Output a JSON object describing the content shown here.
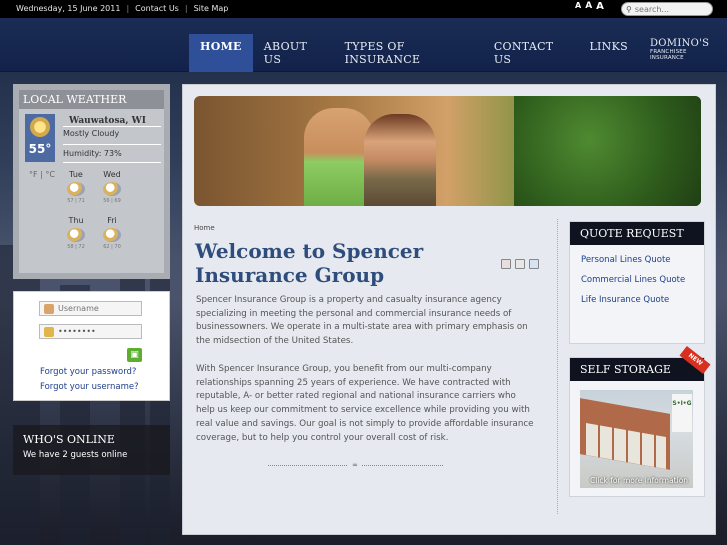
{
  "topbar": {
    "date": "Wednesday, 15 June 2011",
    "links": [
      "Contact Us",
      "Site Map"
    ],
    "font_sizes": [
      "A",
      "A",
      "A"
    ],
    "search_placeholder": "search..."
  },
  "nav": {
    "items": [
      "HOME",
      "ABOUT US",
      "TYPES OF INSURANCE",
      "CONTACT US",
      "LINKS"
    ],
    "dominos_line1": "DOMINO'S",
    "dominos_line2": "FRANCHISEE INSURANCE"
  },
  "weather": {
    "title": "LOCAL WEATHER",
    "city": "Wauwatosa, WI",
    "temp": "55°",
    "condition": "Mostly Cloudy",
    "humidity": "Humidity: 73%",
    "units": "°F | °C",
    "forecast": [
      {
        "day": "Tue",
        "range": "57 | 71"
      },
      {
        "day": "Wed",
        "range": "56 | 69"
      },
      {
        "day": "Thu",
        "range": "58 | 72"
      },
      {
        "day": "Fri",
        "range": "62 | 70"
      }
    ]
  },
  "login": {
    "username_placeholder": "Username",
    "password_value": "••••••••",
    "forgot_password": "Forgot your password?",
    "forgot_username": "Forgot your username?"
  },
  "whos_online": {
    "title": "WHO'S ONLINE",
    "text": "We have 2 guests online"
  },
  "content": {
    "breadcrumb": "Home",
    "title": "Welcome to Spencer Insurance Group",
    "p1": "Spencer Insurance Group is a property and casualty insurance agency specializing in meeting the personal and commercial insurance needs of businessowners. We operate in a multi-state area with primary emphasis on the midsection of the United States.",
    "p2": "With Spencer Insurance Group, you benefit from our multi-company relationships spanning 25 years of experience. We have contracted with reputable, A- or better rated regional and national insurance carriers who help us keep our commitment to service excellence while providing you with real value and savings.  Our goal is not simply to provide affordable insurance coverage, but to help you control your overall cost of risk."
  },
  "quote": {
    "title": "QUOTE REQUEST",
    "links": [
      "Personal Lines Quote",
      "Commercial Lines Quote",
      "Life Insurance Quote"
    ]
  },
  "storage": {
    "title": "SELF STORAGE",
    "ribbon": "NEW",
    "sign": "S•I•G",
    "caption": "Click for more information"
  }
}
